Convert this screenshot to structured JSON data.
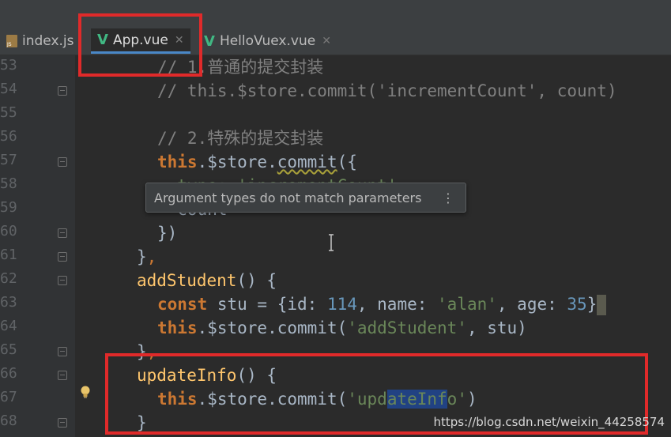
{
  "tabs": [
    {
      "label": "index.js",
      "icon": "js-file-icon",
      "active": false
    },
    {
      "label": "App.vue",
      "icon": "vue-file-icon",
      "active": true
    },
    {
      "label": "HelloVuex.vue",
      "icon": "vue-file-icon",
      "active": false
    }
  ],
  "gutter": {
    "line_numbers": [
      "53",
      "54",
      "55",
      "56",
      "57",
      "58",
      "59",
      "60",
      "61",
      "62",
      "63",
      "64",
      "65",
      "66",
      "67",
      "68"
    ]
  },
  "code": {
    "l53_comment": "// 1.普通的提交封装",
    "l54_comment": "// this.$store.commit('incrementCount', count)",
    "l56_comment": "// 2.特殊的提交封装",
    "l57_this": "this",
    "l57_store": ".$store.",
    "l57_commit": "commit",
    "l57_rest": "({",
    "l58_partial": "  type: 'incrementCount',",
    "l59_partial": "  count",
    "l60": "})",
    "l61_brace": "}",
    "l61_comma": ",",
    "l62_fn": "addStudent",
    "l62_rest": "() {",
    "l63_const": "const",
    "l63_a": " stu = {id: ",
    "l63_num1": "114",
    "l63_b": ", name: ",
    "l63_str": "'alan'",
    "l63_c": ", age: ",
    "l63_num2": "35",
    "l63_d": "}",
    "l64_this": "this",
    "l64_a": ".$store.commit(",
    "l64_str": "'addStudent'",
    "l64_b": ", stu)",
    "l65_brace": "}",
    "l65_comma": ",",
    "l66_fn": "updateInfo",
    "l66_rest": "() {",
    "l67_this": "this",
    "l67_a": ".$store.commit(",
    "l67_str_a": "'upd",
    "l67_str_hl": "ateInf",
    "l67_str_b": "o'",
    "l67_b": ")",
    "l68": "}"
  },
  "tooltip": {
    "text": "Argument types do not match parameters",
    "more_icon": "⋮"
  },
  "watermark": "https://blog.csdn.net/weixin_44258574",
  "colors": {
    "background": "#2b2b2b",
    "annotation_red": "#e02a2a",
    "vue_green": "#41b883"
  }
}
